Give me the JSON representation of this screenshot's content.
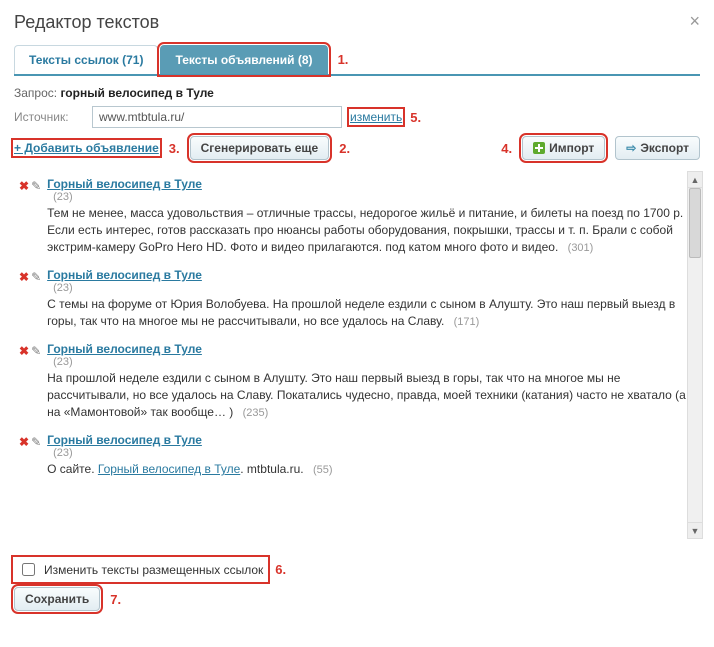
{
  "dialog": {
    "title": "Редактор текстов",
    "close": "×"
  },
  "tabs": {
    "links": "Тексты ссылок (71)",
    "ads": "Тексты объявлений (8)"
  },
  "queryLabel": "Запрос:",
  "queryValue": "горный велосипед в Туле",
  "sourceLabel": "Источник:",
  "sourceValue": "www.mtbtula.ru/",
  "actions": {
    "change": "изменить",
    "add": "+ Добавить объявление",
    "generate": "Сгенерировать еще",
    "import": "Импорт",
    "export": "Экспорт"
  },
  "numbers": {
    "n1": "1.",
    "n2": "2.",
    "n3": "3.",
    "n4": "4.",
    "n5": "5.",
    "n6": "6.",
    "n7": "7."
  },
  "items": [
    {
      "title": "Горный велосипед в Туле",
      "count": "(23)",
      "text": "Тем не менее, масса удовольствия – отличные трассы, недорогое жильё и питание, и билеты на поезд по 1700 р. Если есть интерес, готов рассказать про нюансы работы оборудования, покрышки, трассы и т. п. Брали с собой экстрим-камеру GoPro Hero HD. Фото и видео прилагаются. под катом много фото и видео.",
      "tail": "(301)"
    },
    {
      "title": "Горный велосипед в Туле",
      "count": "(23)",
      "text": "С темы на форуме от Юрия Волобуева. На прошлой неделе ездили с сыном в Алушту. Это наш первый выезд в горы, так что на многое мы не рассчитывали, но все удалось на Славу.",
      "tail": "(171)"
    },
    {
      "title": "Горный велосипед в Туле",
      "count": "(23)",
      "text": "На прошлой неделе ездили с сыном в Алушту. Это наш первый выезд в горы, так что на многое мы не рассчитывали, но все удалось на Славу. Покатались чудесно, правда, моей техники (катания) часто не хватало (а на «Мамонтовой» так вообще… )",
      "tail": "(235)"
    },
    {
      "title": "Горный велосипед в Туле",
      "count": "(23)",
      "pre": "О сайте. ",
      "inline": "Горный велосипед в Туле",
      "post": ". mtbtula.ru.",
      "tail": "(55)"
    }
  ],
  "footer": {
    "changeLinks": "Изменить тексты размещенных ссылок",
    "save": "Сохранить"
  }
}
